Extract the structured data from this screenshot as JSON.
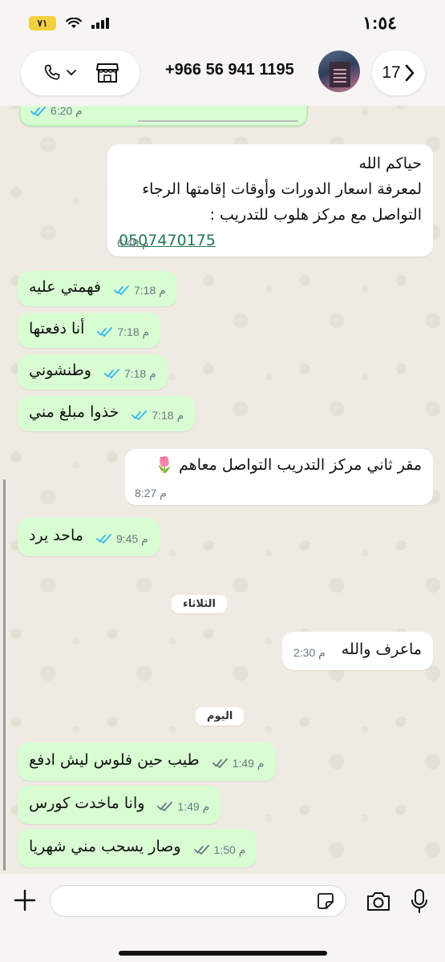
{
  "status_bar": {
    "time": "١:٥٤",
    "battery": "٧١"
  },
  "header": {
    "contact": "+966 56 941 1195",
    "back_count": "17"
  },
  "messages": [
    {
      "dir": "out",
      "text": "",
      "time": "6:20 م",
      "partial": true
    },
    {
      "dir": "in",
      "text": "حياكم الله\nلمعرفة اسعار الدورات وأوقات إقامتها الرجاء\nالتواصل مع مركز هلوب للتدريب :",
      "link": "0507470175",
      "time": "6:49 م"
    },
    {
      "dir": "out",
      "text": "فهمتي عليه",
      "time": "7:18 م"
    },
    {
      "dir": "out",
      "text": "أنا دفعتها",
      "time": "7:18 م"
    },
    {
      "dir": "out",
      "text": "وطنشوني",
      "time": "7:18 م"
    },
    {
      "dir": "out",
      "text": "خذوا مبلغ مني",
      "time": "7:18 م"
    },
    {
      "dir": "in",
      "text": "مقر ثاني مركز التدريب التواصل معاهم 🌷",
      "time": "8:27 م"
    },
    {
      "dir": "out",
      "text": "ماحد يرد",
      "time": "9:45 م"
    },
    {
      "dir": "in",
      "text": "ماعرف والله",
      "time": "2:30 م"
    },
    {
      "dir": "out",
      "text": "طيب حين فلوس ليش ادفع",
      "time": "1:49 م"
    },
    {
      "dir": "out",
      "text": "وانا ماخدت كورس",
      "time": "1:49 م"
    },
    {
      "dir": "out",
      "text": "وصار يسحب مني شهريا",
      "time": "1:50 م"
    }
  ],
  "day_separators": {
    "tuesday": "الثلاثاء",
    "today": "اليوم"
  },
  "input": {
    "value": "",
    "placeholder": ""
  },
  "colors": {
    "outgoing_bubble": "#d9fdd3",
    "incoming_bubble": "#ffffff",
    "wallpaper": "#efeae2",
    "read_tick": "#34b7f1",
    "sent_tick": "#667781",
    "link": "#1f7a4c"
  },
  "icons": [
    "phone-icon",
    "chevron-down-icon",
    "store-icon",
    "chevron-right-icon",
    "plus-icon",
    "sticker-icon",
    "camera-icon",
    "mic-icon",
    "wifi-icon",
    "signal-icon",
    "read-ticks-icon"
  ]
}
